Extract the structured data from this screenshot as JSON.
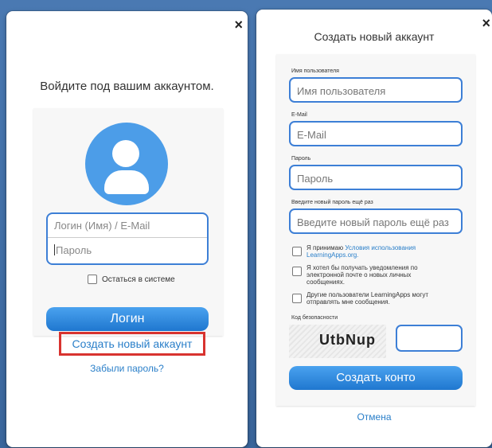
{
  "login": {
    "title": "Войдите под вашим аккаунтом.",
    "login_placeholder": "Логин (Имя) / E-Mail",
    "password_placeholder": "Пароль",
    "remember": "Остаться в системе",
    "login_button": "Логин",
    "create_account_link": "Создать новый аккаунт",
    "forgot_password_link": "Забыли пароль?",
    "close": "×"
  },
  "register": {
    "title": "Создать новый аккаунт",
    "close": "×",
    "username_label": "Имя пользователя",
    "username_placeholder": "Имя пользователя",
    "email_label": "E-Mail",
    "email_placeholder": "E-Mail",
    "password_label": "Пароль",
    "password_placeholder": "Пароль",
    "password2_label": "Введите новый пароль ещё раз",
    "password2_placeholder": "Введите новый пароль ещё раз",
    "accept_text": "Я принимаю",
    "terms_link": "Условия использования LearningApps.org.",
    "notify_text": "Я хотел бы получать уведомления по электронной почте о новых личных сообщениях.",
    "others_text": "Другие пользователи LearningApps могут отправлять мне сообщения.",
    "captcha_label": "Код безопасности",
    "captcha_code": "UtbNup",
    "create_button": "Создать конто",
    "cancel_link": "Отмена"
  }
}
